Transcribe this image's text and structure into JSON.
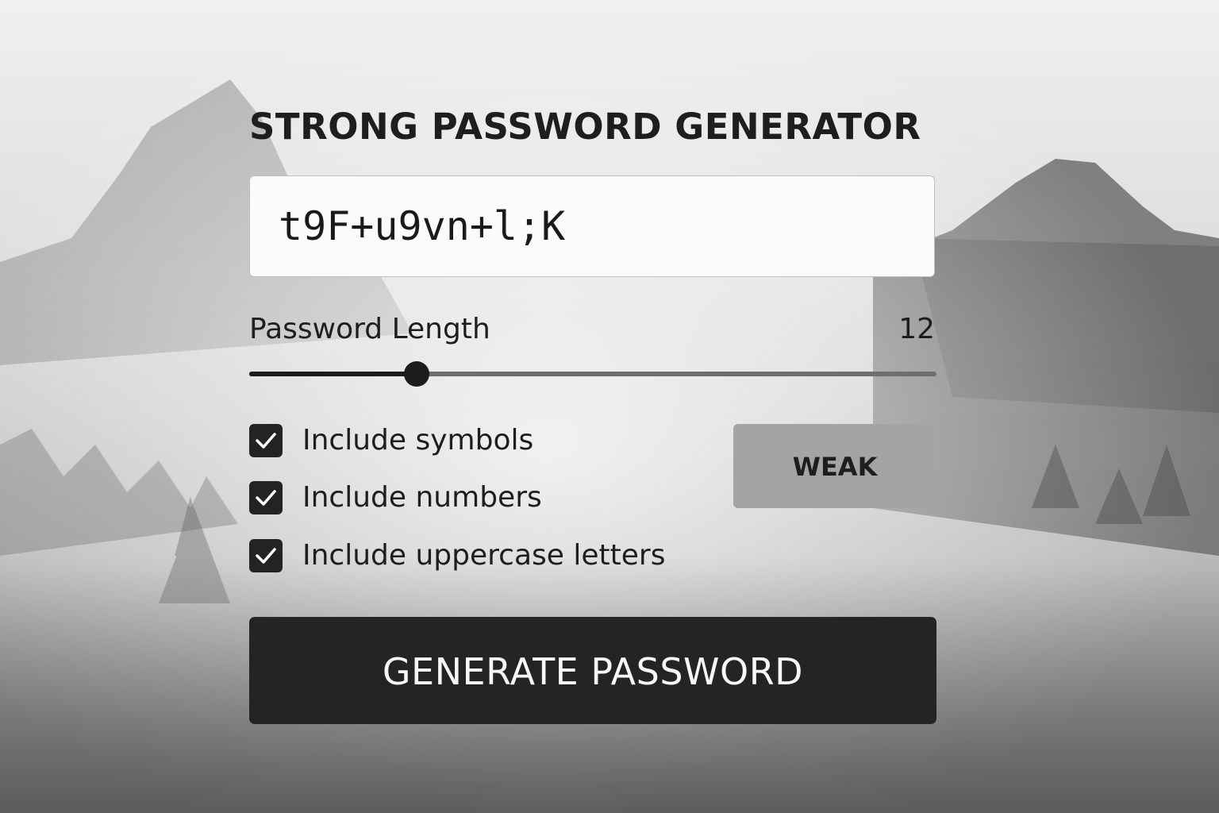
{
  "colors": {
    "panel_accent": "#242424",
    "strength_badge": "#a4a4a4",
    "input_background": "#fbfbfb"
  },
  "header": {
    "title": "STRONG PASSWORD GENERATOR"
  },
  "password": {
    "value": "t9F+u9vn+l;K"
  },
  "length": {
    "label": "Password Length",
    "value": "12",
    "slider_fraction": 0.244
  },
  "options": [
    {
      "label": "Include symbols",
      "checked": true,
      "icon": "checkmark-icon"
    },
    {
      "label": "Include numbers",
      "checked": true,
      "icon": "checkmark-icon"
    },
    {
      "label": "Include uppercase letters",
      "checked": true,
      "icon": "checkmark-icon"
    }
  ],
  "strength": {
    "label": "WEAK"
  },
  "actions": {
    "generate_label": "GENERATE PASSWORD"
  }
}
